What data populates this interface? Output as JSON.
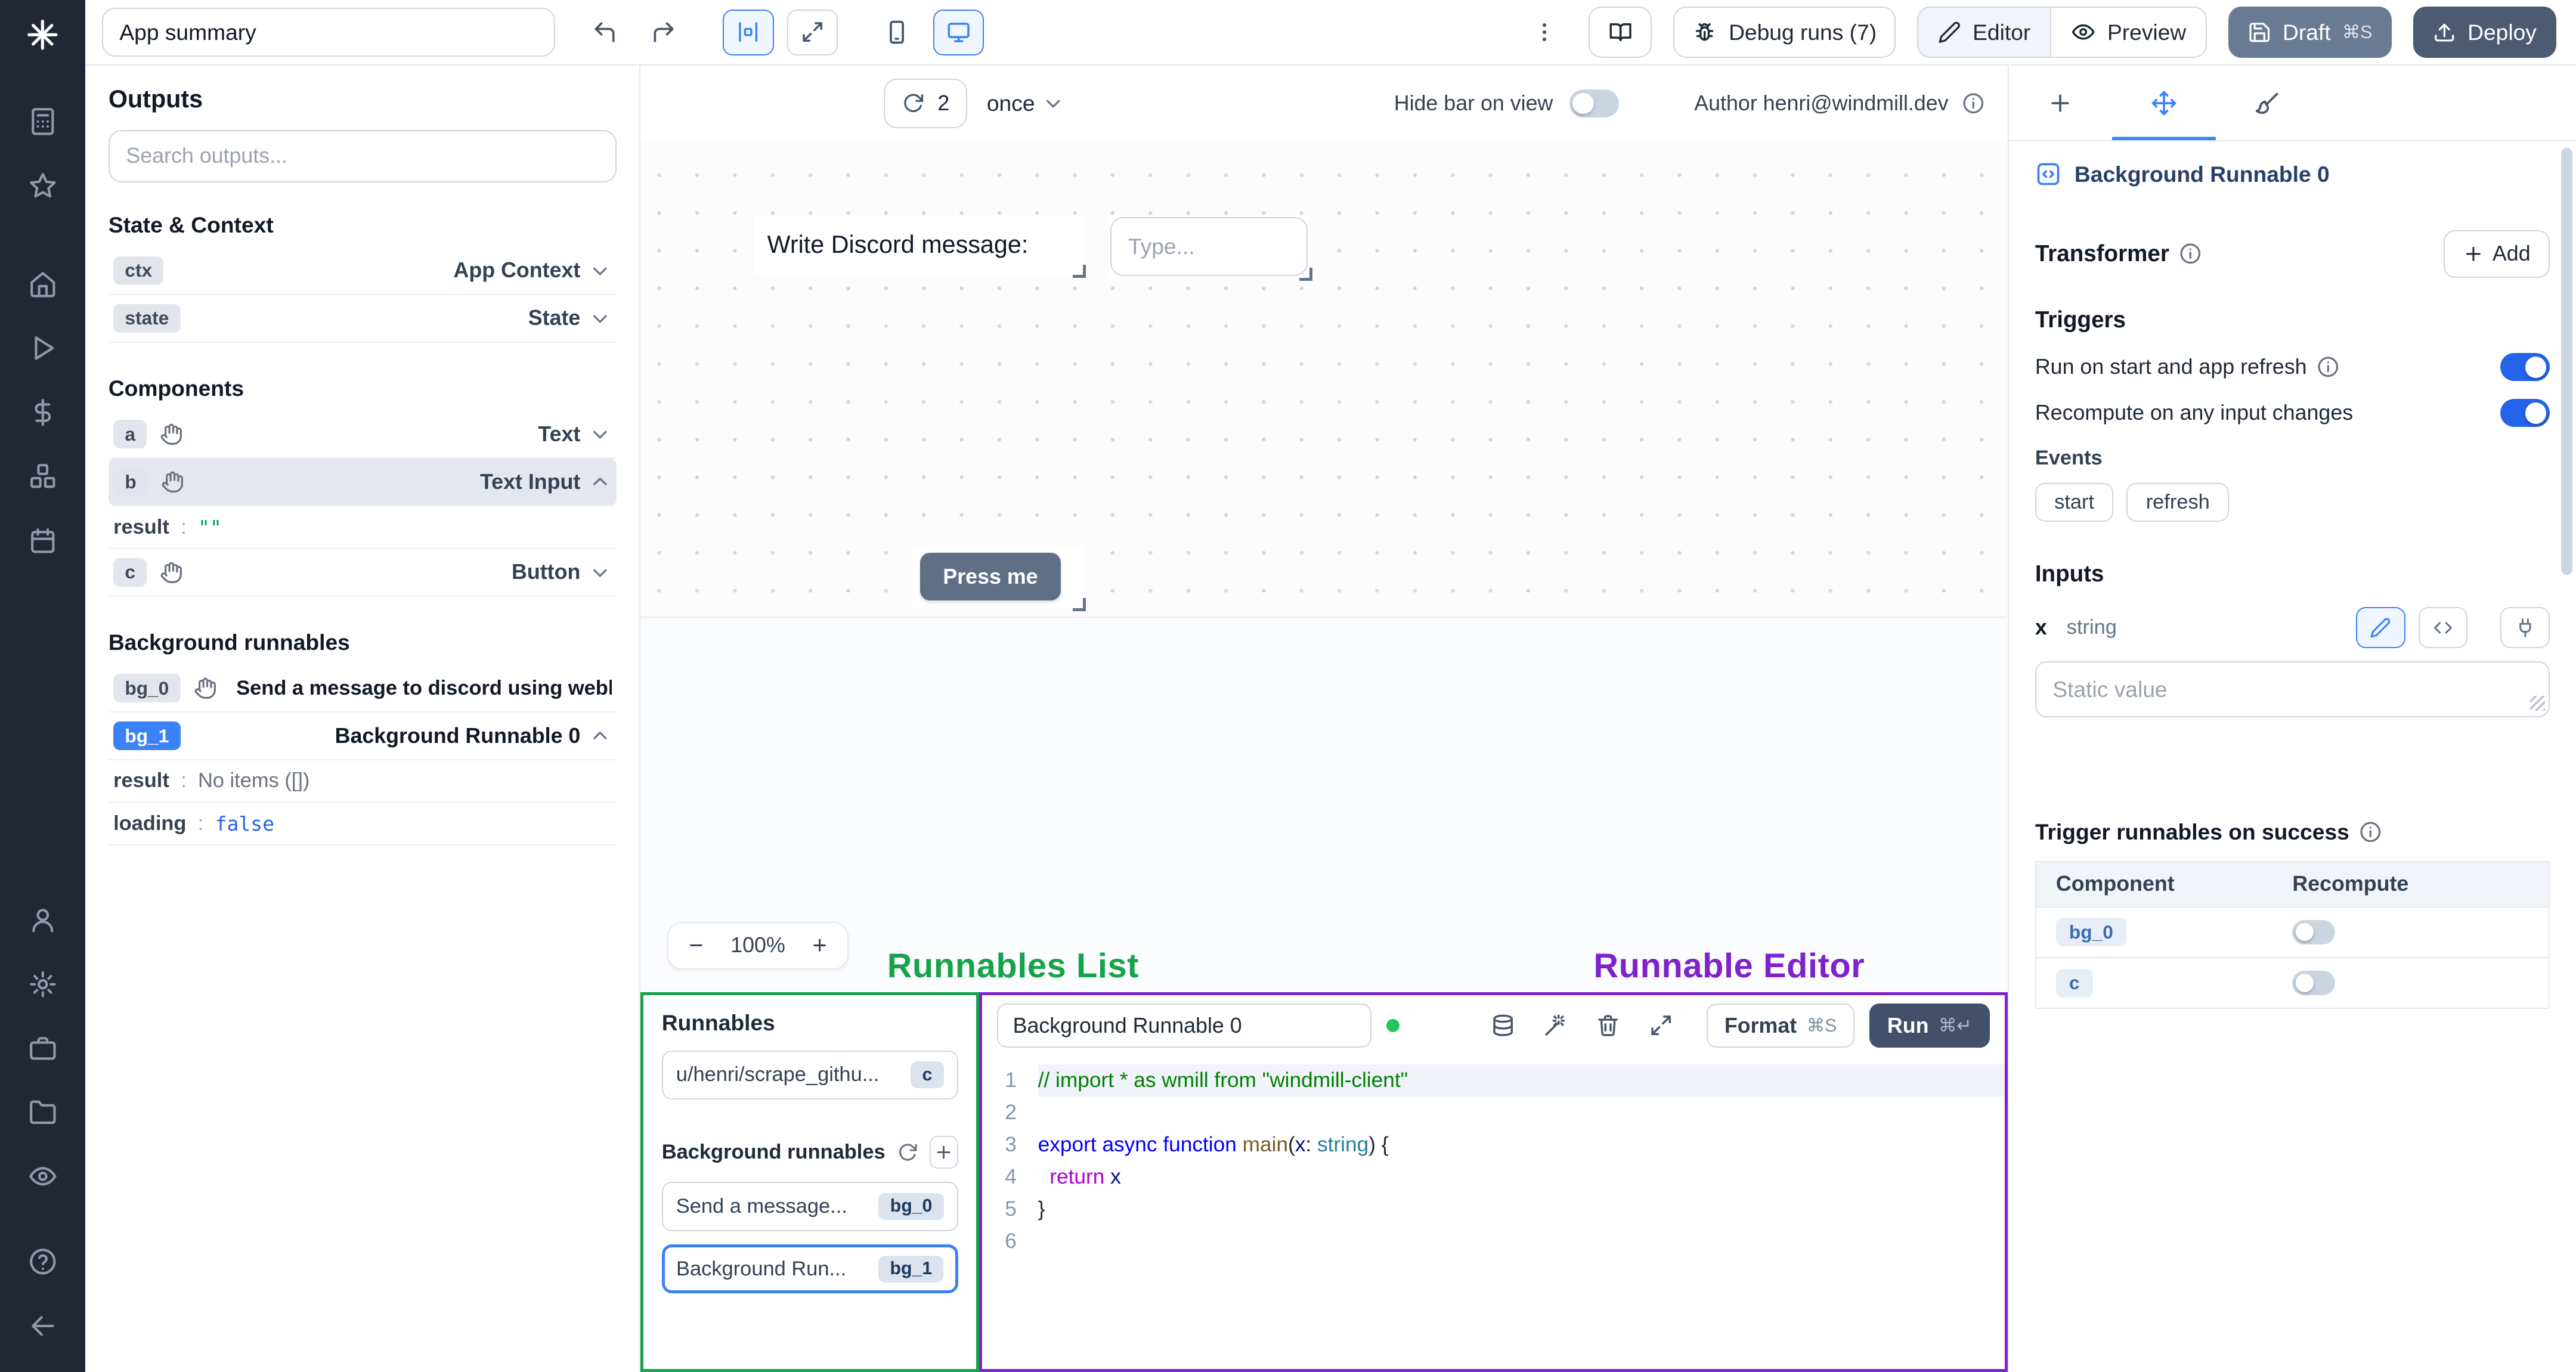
{
  "colors": {
    "accent": "#3b82f6",
    "annotation_green": "#16a34a",
    "annotation_purple": "#7e22ce"
  },
  "topbar": {
    "app_summary": "App summary",
    "debug_runs": "Debug runs (7)",
    "editor": "Editor",
    "preview": "Preview",
    "draft": "Draft",
    "draft_kbd": "⌘S",
    "deploy": "Deploy"
  },
  "outputs": {
    "title": "Outputs",
    "search_placeholder": "Search outputs...",
    "state_context_heading": "State & Context",
    "components_heading": "Components",
    "background_heading": "Background runnables",
    "colon": ":",
    "ctx": {
      "badge": "ctx",
      "label": "App Context"
    },
    "state": {
      "badge": "state",
      "label": "State"
    },
    "a": {
      "badge": "a",
      "label": "Text"
    },
    "b": {
      "badge": "b",
      "label": "Text Input"
    },
    "b_result_key": "result",
    "b_result_value": "\"\"",
    "c": {
      "badge": "c",
      "label": "Button"
    },
    "bg0": {
      "badge": "bg_0",
      "label": "Send a message to discord using webhoo"
    },
    "bg1": {
      "badge": "bg_1",
      "label": "Background Runnable 0"
    },
    "bg1_result_key": "result",
    "bg1_result_value": "No items ([])",
    "bg1_loading_key": "loading",
    "bg1_loading_value": "false"
  },
  "canvas_bar": {
    "refresh_count": "2",
    "frequency": "once",
    "hide_bar_label": "Hide bar on view",
    "author": "Author henri@windmill.dev"
  },
  "canvas": {
    "text_component": "Write Discord message:",
    "input_placeholder": "Type...",
    "button_label": "Press me",
    "zoom_out": "−",
    "zoom": "100%",
    "zoom_in": "+"
  },
  "annotations": {
    "list": "Runnables List",
    "editor": "Runnable Editor"
  },
  "runnables": {
    "title": "Runnables",
    "script_item": {
      "label": "u/henri/scrape_githu...",
      "badge": "c"
    },
    "bg_heading": "Background runnables",
    "bg0_item": {
      "label": "Send a message...",
      "badge": "bg_0"
    },
    "bg1_item": {
      "label": "Background Run...",
      "badge": "bg_1"
    }
  },
  "editor": {
    "title": "Background Runnable 0",
    "format": "Format",
    "format_kbd": "⌘S",
    "run": "Run",
    "run_kbd": "⌘↵",
    "lines": [
      [
        {
          "t": "// import * as wmill from \"windmill-client\"",
          "c": "comment"
        }
      ],
      [],
      [
        {
          "t": "export",
          "c": "kw"
        },
        {
          "t": " ",
          "c": "plain"
        },
        {
          "t": "async",
          "c": "kw"
        },
        {
          "t": " ",
          "c": "plain"
        },
        {
          "t": "function",
          "c": "kw"
        },
        {
          "t": " ",
          "c": "plain"
        },
        {
          "t": "main",
          "c": "fn"
        },
        {
          "t": "(",
          "c": "plain"
        },
        {
          "t": "x",
          "c": "param"
        },
        {
          "t": ": ",
          "c": "plain"
        },
        {
          "t": "string",
          "c": "type"
        },
        {
          "t": ")",
          "c": "plain"
        },
        {
          "t": " {",
          "c": "plain"
        }
      ],
      [
        {
          "t": "  ",
          "c": "plain"
        },
        {
          "t": "return",
          "c": "ctrl"
        },
        {
          "t": " x",
          "c": "param"
        }
      ],
      [
        {
          "t": "}",
          "c": "plain"
        }
      ],
      []
    ]
  },
  "settings": {
    "runnable_name": "Background Runnable 0",
    "transformer": "Transformer",
    "add": "Add",
    "triggers": "Triggers",
    "trigger_start": "Run on start and app refresh",
    "trigger_recompute": "Recompute on any input changes",
    "events": "Events",
    "event_start": "start",
    "event_refresh": "refresh",
    "inputs": "Inputs",
    "input_name": "x",
    "input_type": "string",
    "static_placeholder": "Static value",
    "on_success": "Trigger runnables on success",
    "col_component": "Component",
    "col_recompute": "Recompute",
    "row1_badge": "bg_0",
    "row2_badge": "c"
  }
}
